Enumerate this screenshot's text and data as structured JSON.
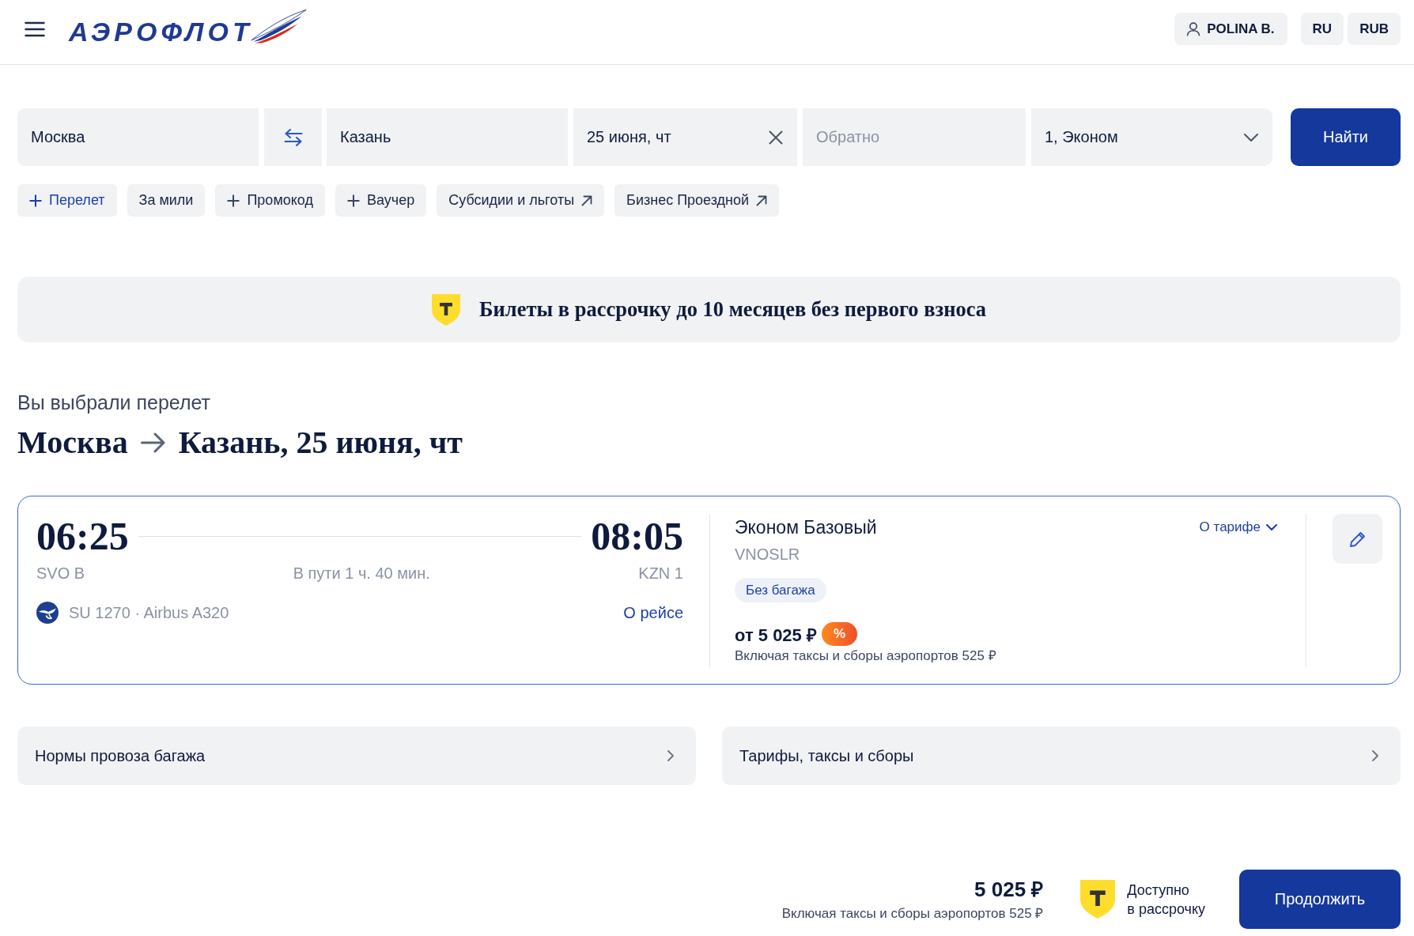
{
  "header": {
    "logo": "АЭРОФЛОТ",
    "user": "POLINA B.",
    "language": "RU",
    "currency": "RUB"
  },
  "search": {
    "origin": "Москва",
    "destination": "Казань",
    "departure_date": "25 июня, чт",
    "return_date": {
      "placeholder": "Обратно"
    },
    "passengers": "1, Эконом",
    "submit": "Найти"
  },
  "options": [
    {
      "label": "Перелет",
      "kind": "add_primary"
    },
    {
      "label": "За мили",
      "kind": "plain"
    },
    {
      "label": "Промокод",
      "kind": "add"
    },
    {
      "label": "Ваучер",
      "kind": "add"
    },
    {
      "label": "Субсидии и льготы",
      "kind": "external"
    },
    {
      "label": "Бизнес Проездной",
      "kind": "external"
    }
  ],
  "banner": {
    "text": "Билеты в рассрочку до 10 месяцев без первого взноса"
  },
  "selection": {
    "subtitle": "Вы выбрали перелет",
    "origin": "Москва",
    "destination": "Казань, 25 июня, чт"
  },
  "flight": {
    "selected": true,
    "departure": {
      "time": "06:25",
      "airport": "SVO B"
    },
    "duration": "В пути 1 ч. 40 мин.",
    "arrival": {
      "time": "08:05",
      "airport": "KZN 1"
    },
    "flight_info": "SU 1270 · Airbus A320",
    "details_link": "О рейсе",
    "fare": {
      "name": "Эконом Базовый",
      "code": "VNOSLR",
      "tag": "Без багажа",
      "price": "от 5 025 ₽",
      "badge": "%",
      "note": "Включая таксы и сборы аэропортов 525 ₽",
      "details_link": "О тарифе"
    }
  },
  "info_links": [
    {
      "label": "Нормы провоза багажа"
    },
    {
      "label": "Тарифы, таксы и сборы"
    }
  ],
  "summary": {
    "total": "5 025 ₽",
    "note": "Включая таксы и сборы аэропортов 525 ₽",
    "installment": "Доступно\nв рассрочку",
    "continue": "Продолжить"
  }
}
